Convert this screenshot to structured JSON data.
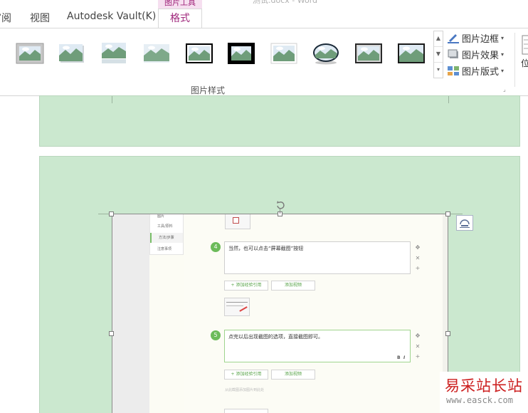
{
  "window": {
    "doc_title": "测试.docx - Word"
  },
  "tabs": {
    "review": "审阅",
    "view": "视图",
    "vault": "Autodesk Vault(K)",
    "context_group": "图片工具",
    "format": "格式"
  },
  "ribbon": {
    "picture_border": "图片边框",
    "picture_effects": "图片效果",
    "picture_layout": "图片版式",
    "group_label": "图片样式",
    "position_label": "位"
  },
  "inserted_image": {
    "nav_items": [
      "图片",
      "工具/原料",
      "方法/步骤",
      "注意事项"
    ],
    "step4_number": "4",
    "step4_text": "当然，也可以点击“屏幕截图”按钮",
    "step5_number": "5",
    "step5_text": "点完以后出现截图的选项，直接截图即可。",
    "add_reference": "+ 添加经验引用",
    "add_video": "添加视频",
    "faint_note": "从此截图添加图片到此处",
    "bold_btn": "B",
    "italic_btn": "I"
  },
  "watermark": {
    "title": "易采站长站",
    "url": "www.easck.com"
  }
}
